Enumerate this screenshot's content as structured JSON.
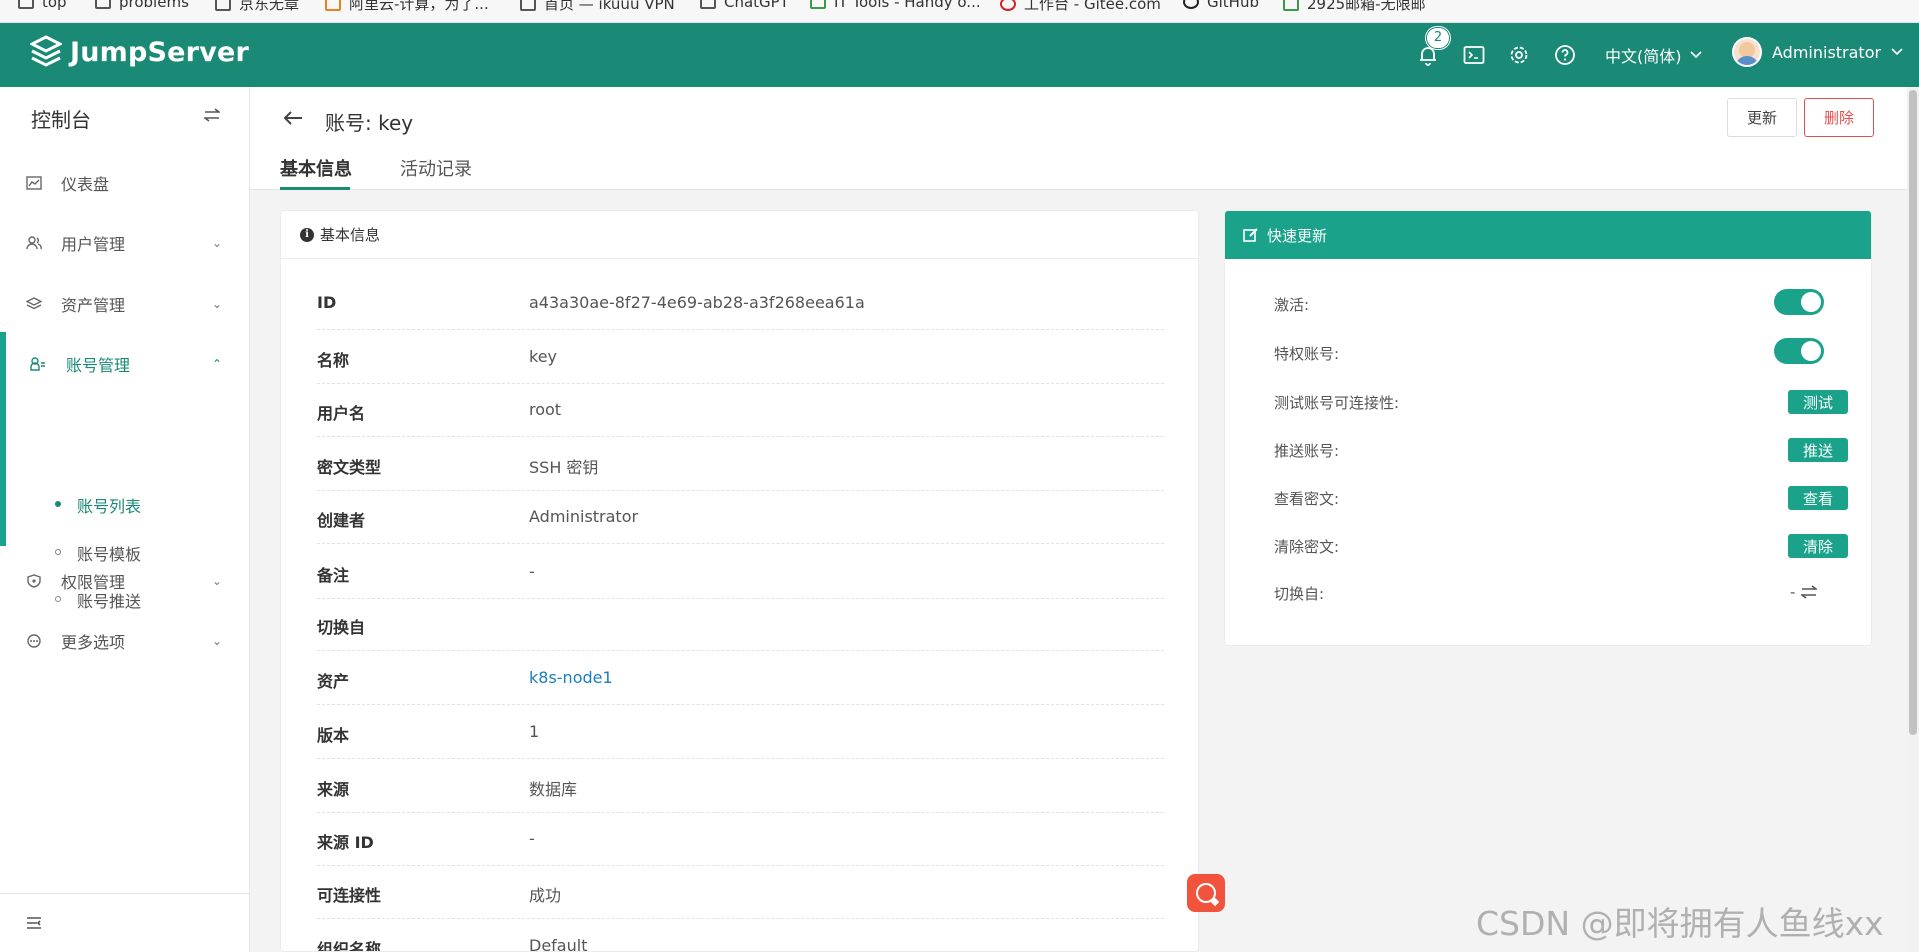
{
  "bookmarks": [
    "top",
    "problems",
    "京东无章",
    "阿里云-计算，为了...",
    "首页 — ikuuu VPN",
    "ChatGPT",
    "IT Tools - Handy o...",
    "工作台 - Gitee.com",
    "GitHub",
    "2925邮箱-无限邮"
  ],
  "header": {
    "brand": "JumpServer",
    "notification_count": "2",
    "language": "中文(简体)",
    "user": "Administrator",
    "color": "#1a8a76"
  },
  "sidebar": {
    "title": "控制台",
    "items": [
      {
        "label": "仪表盘",
        "icon": "chart-icon"
      },
      {
        "label": "用户管理",
        "icon": "users-icon"
      },
      {
        "label": "资产管理",
        "icon": "layers-icon"
      },
      {
        "label": "账号管理",
        "icon": "account-icon"
      },
      {
        "label": "权限管理",
        "icon": "shield-icon"
      },
      {
        "label": "更多选项",
        "icon": "more-icon"
      }
    ],
    "sub_items": [
      "账号列表",
      "账号模板",
      "账号推送"
    ]
  },
  "page": {
    "title": "账号: key",
    "update_label": "更新",
    "delete_label": "删除",
    "tabs": [
      "基本信息",
      "活动记录"
    ]
  },
  "info_card": {
    "title": "基本信息",
    "rows": [
      {
        "key": "ID",
        "value": "a43a30ae-8f27-4e69-ab28-a3f268eea61a"
      },
      {
        "key": "名称",
        "value": "key"
      },
      {
        "key": "用户名",
        "value": "root"
      },
      {
        "key": "密文类型",
        "value": "SSH 密钥"
      },
      {
        "key": "创建者",
        "value": "Administrator"
      },
      {
        "key": "备注",
        "value": "-"
      },
      {
        "key": "切换自",
        "value": ""
      },
      {
        "key": "资产",
        "value": "k8s-node1"
      },
      {
        "key": "版本",
        "value": "1"
      },
      {
        "key": "来源",
        "value": "数据库"
      },
      {
        "key": "来源 ID",
        "value": "-"
      },
      {
        "key": "可连接性",
        "value": "成功"
      },
      {
        "key": "组织名称",
        "value": "Default"
      }
    ]
  },
  "quick_card": {
    "title": "快速更新",
    "active_label": "激活:",
    "active_on": true,
    "privileged_label": "特权账号:",
    "privileged_on": true,
    "test_label": "测试账号可连接性:",
    "test_btn": "测试",
    "push_label": "推送账号:",
    "push_btn": "推送",
    "view_label": "查看密文:",
    "view_btn": "查看",
    "clear_label": "清除密文:",
    "clear_btn": "清除",
    "switch_label": "切换自:",
    "switch_value": "-"
  },
  "watermark": "CSDN @即将拥有人鱼线xx"
}
